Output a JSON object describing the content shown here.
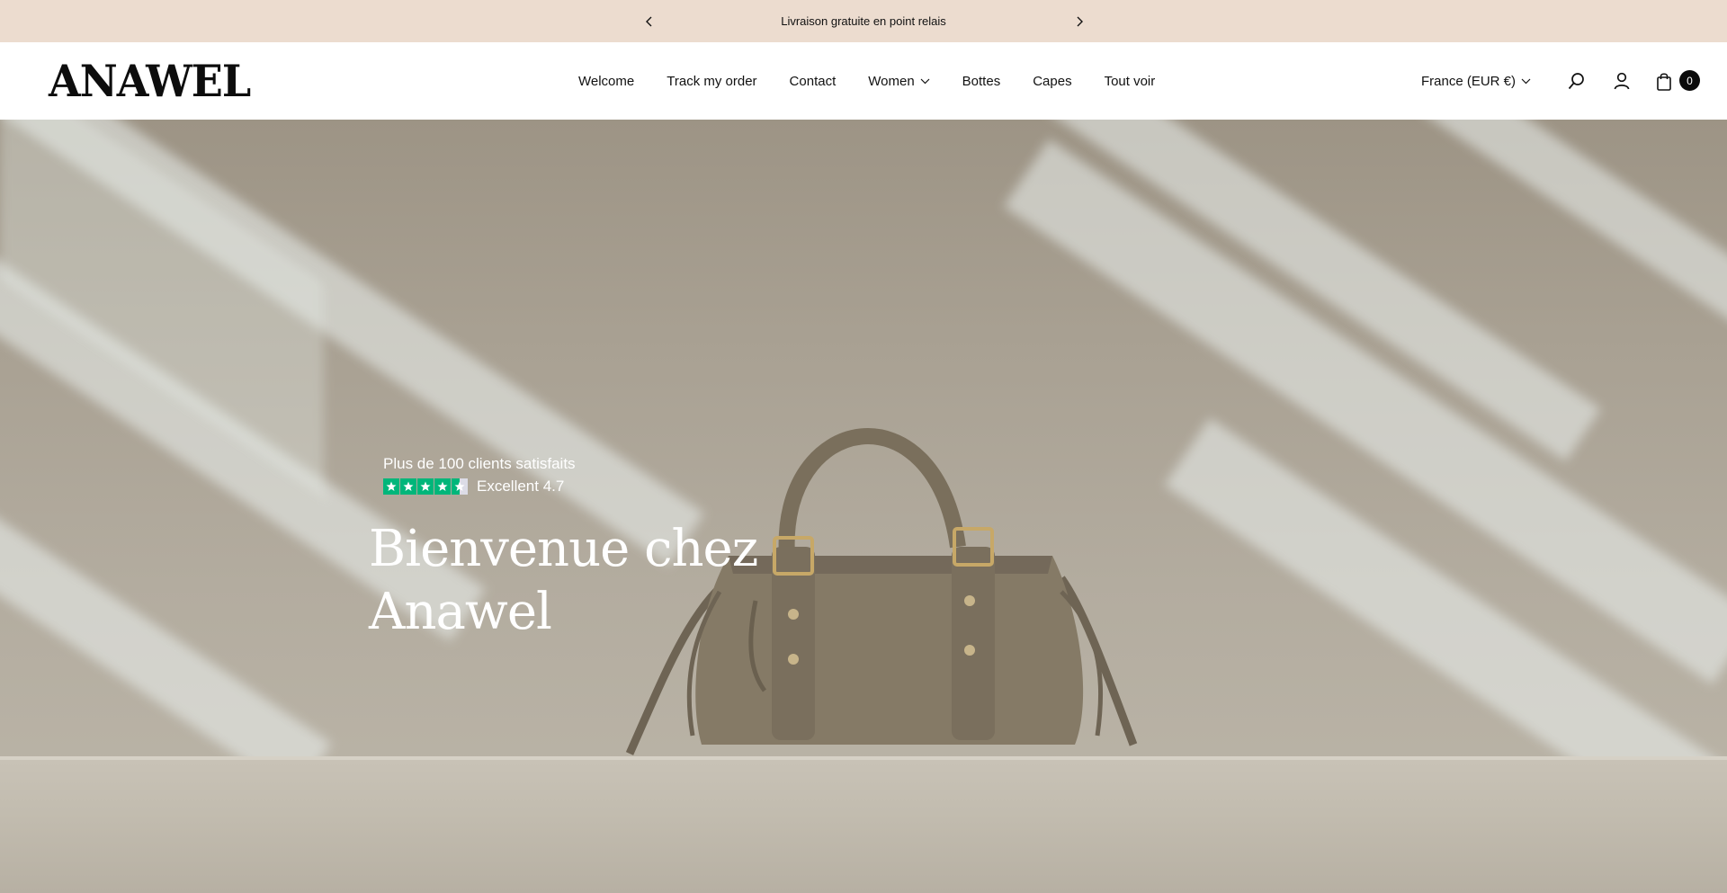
{
  "announcement": {
    "text": "Livraison gratuite en point relais"
  },
  "header": {
    "logo": "ANAWEL",
    "nav": [
      {
        "label": "Welcome"
      },
      {
        "label": "Track my order"
      },
      {
        "label": "Contact"
      },
      {
        "label": "Women",
        "has_dropdown": true
      },
      {
        "label": "Bottes"
      },
      {
        "label": "Capes"
      },
      {
        "label": "Tout voir"
      }
    ],
    "country_selector": "France (EUR €)",
    "cart_count": "0",
    "icons": [
      "search-icon",
      "account-icon",
      "cart-icon"
    ]
  },
  "hero": {
    "subtitle": "Plus de 100 clients satisfaits",
    "rating_text": "Excellent 4.7",
    "rating_value": 4.7,
    "rating_max": 5,
    "title": "Bienvenue chez Anawel"
  },
  "colors": {
    "announcement_bg": "#ecdccf",
    "star_green": "#00b67a",
    "cart_badge": "#0b0b0b"
  }
}
